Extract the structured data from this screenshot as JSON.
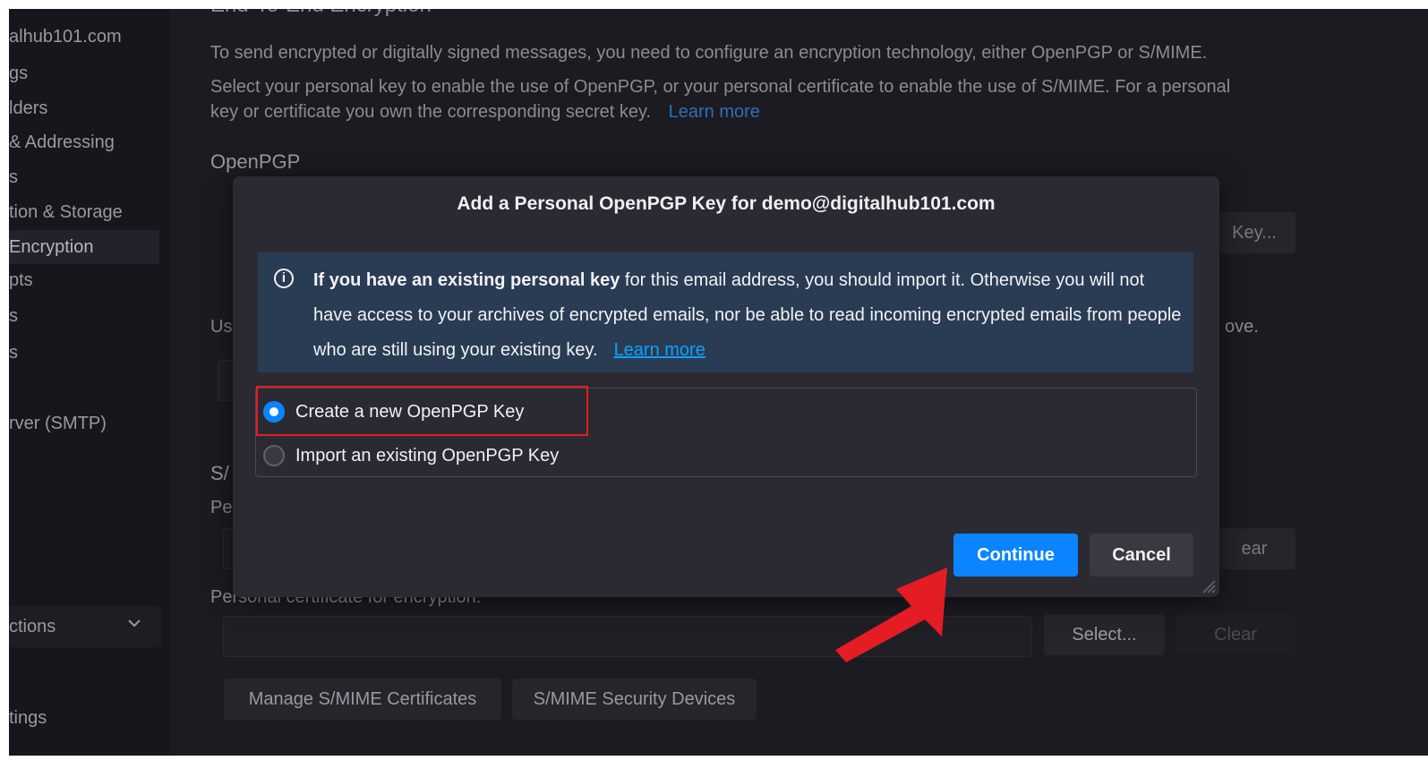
{
  "sidebar": {
    "items": [
      {
        "label": "alhub101.com"
      },
      {
        "label": "gs"
      },
      {
        "label": "lders"
      },
      {
        "label": "& Addressing"
      },
      {
        "label": "s"
      },
      {
        "label": "tion & Storage"
      },
      {
        "label": "Encryption"
      },
      {
        "label": "pts"
      },
      {
        "label": "s"
      },
      {
        "label": "s"
      },
      {
        "label": "rver (SMTP)"
      },
      {
        "label": "ctions"
      },
      {
        "label": "tings"
      }
    ]
  },
  "main": {
    "section_title": "End-To-End Encryption",
    "desc_line1": "To send encrypted or digitally signed messages, you need to configure an encryption technology, either OpenPGP or S/MIME.",
    "desc_line2": "Select your personal key to enable the use of OpenPGP, or your personal certificate to enable the use of S/MIME. For a personal",
    "desc_line3": "key or certificate you own the corresponding secret key.",
    "learn_more": "Learn more",
    "openpgp_heading": "OpenPGP",
    "add_key_fragment": "Key...",
    "use_fragment": "Us",
    "above_fragment": "ove.",
    "smime_fragment": "S/",
    "personal_fragment": "Pe",
    "clear_fragment": "ear",
    "encryption_cert_label": "Personal certificate for encryption:",
    "select_button": "Select...",
    "clear_button": "Clear",
    "manage_button": "Manage S/MIME Certificates",
    "devices_button": "S/MIME Security Devices"
  },
  "dialog": {
    "title": "Add a Personal OpenPGP Key for demo@digitalhub101.com",
    "info_bold": "If you have an existing personal key",
    "info_rest": " for this email address, you should import it. Otherwise you will not have access to your archives of encrypted emails, nor be able to read incoming encrypted emails from people who are still using your existing key.",
    "info_link": "Learn more",
    "option_create": "Create a new OpenPGP Key",
    "option_import": "Import an existing OpenPGP Key",
    "continue_label": "Continue",
    "cancel_label": "Cancel"
  },
  "colors": {
    "accent": "#0a84ff",
    "highlight": "#e41c24",
    "background": "#1c1b22"
  },
  "icons": {
    "info": "info-circle-icon",
    "chevron": "chevron-down-icon",
    "arrow": "red-arrow-annotation"
  }
}
